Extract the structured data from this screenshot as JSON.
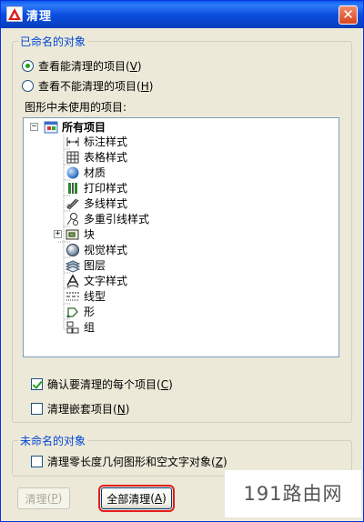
{
  "window": {
    "title": "清理",
    "close_glyph": "✕"
  },
  "named_objects": {
    "legend": "已命名的对象",
    "radio_view_purgeable": {
      "text": "查看能清理的项目",
      "key": "V"
    },
    "radio_view_nonpurgeable": {
      "text": "查看不能清理的项目",
      "key": "H"
    },
    "tree_label": "图形中未使用的项目:",
    "tree": {
      "root": "所有项目",
      "items": [
        {
          "label": "标注样式",
          "icon": "dimension-style-icon"
        },
        {
          "label": "表格样式",
          "icon": "table-style-icon"
        },
        {
          "label": "材质",
          "icon": "material-icon"
        },
        {
          "label": "打印样式",
          "icon": "plot-style-icon"
        },
        {
          "label": "多线样式",
          "icon": "multiline-style-icon"
        },
        {
          "label": "多重引线样式",
          "icon": "multileader-style-icon"
        },
        {
          "label": "块",
          "icon": "block-icon",
          "expandable": true,
          "expander": "+"
        },
        {
          "label": "视觉样式",
          "icon": "visual-style-icon"
        },
        {
          "label": "图层",
          "icon": "layer-icon"
        },
        {
          "label": "文字样式",
          "icon": "text-style-icon"
        },
        {
          "label": "线型",
          "icon": "linetype-icon"
        },
        {
          "label": "形",
          "icon": "shape-icon"
        },
        {
          "label": "组",
          "icon": "group-icon"
        }
      ],
      "root_expander": "−"
    },
    "checkbox_confirm": {
      "text": "确认要清理的每个项目",
      "key": "C",
      "checked": true
    },
    "checkbox_nested": {
      "text": "清理嵌套项目",
      "key": "N",
      "checked": false
    }
  },
  "unnamed_objects": {
    "legend": "未命名的对象",
    "checkbox_zero_length": {
      "text": "清理零长度几何图形和空文字对象",
      "key": "Z",
      "checked": false
    }
  },
  "buttons": {
    "purge": {
      "text": "清理",
      "key": "P"
    },
    "purge_all": {
      "text": "全部清理",
      "key": "A"
    }
  },
  "watermark": "191路由网",
  "colors": {
    "legend": "#0046d5",
    "highlight": "#e41e1e",
    "titlebar": "#0a4fe0"
  }
}
